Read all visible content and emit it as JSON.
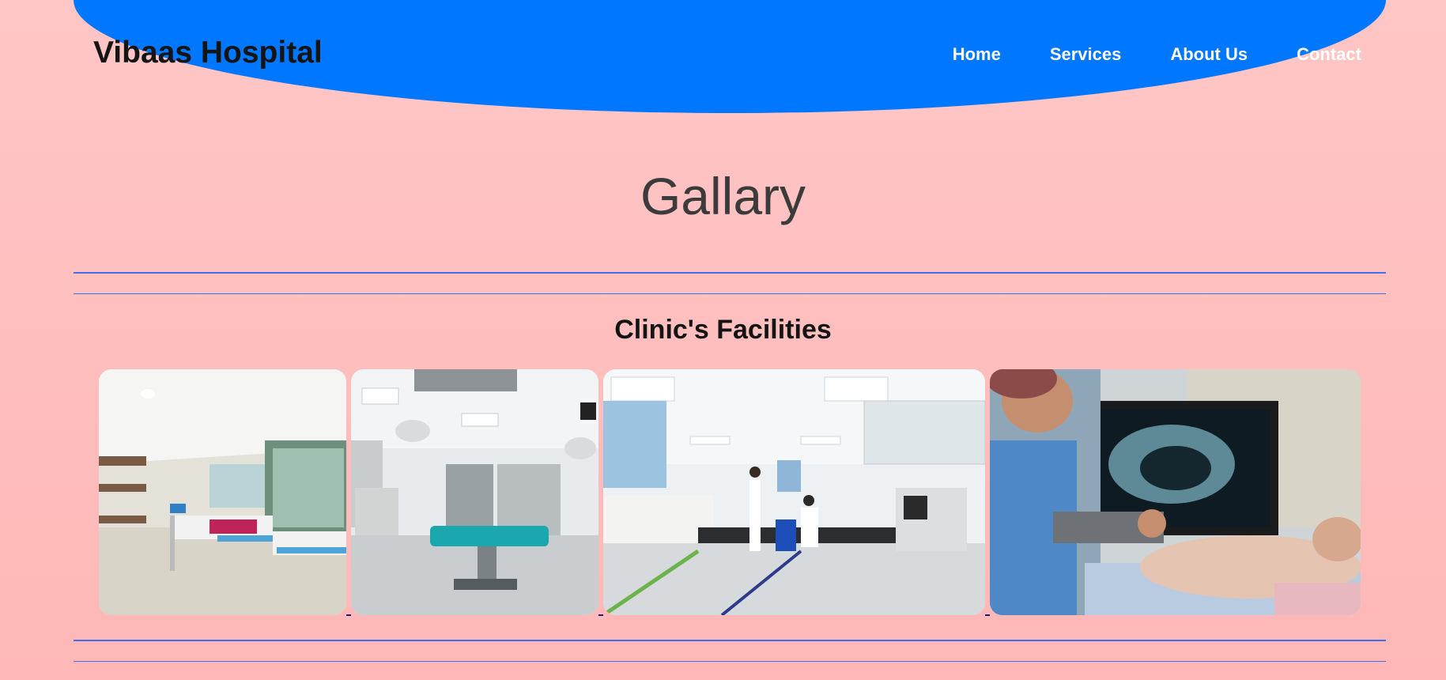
{
  "header": {
    "brand": "Vibaas Hospital",
    "nav": [
      "Home",
      "Services",
      "About Us",
      "Contact"
    ],
    "color": "#0077ff"
  },
  "page_title": "Gallary",
  "section": {
    "title": "Clinic's Facilities"
  },
  "gallery": {
    "photos": [
      {
        "icon": "hospital-ward-photo"
      },
      {
        "icon": "operation-theatre-photo"
      },
      {
        "icon": "laboratory-photo"
      },
      {
        "icon": "ultrasound-photo"
      }
    ]
  },
  "colors": {
    "background": "#ffc0c0",
    "rule": "#3f6ff0",
    "title_text": "#3b3b3b"
  }
}
